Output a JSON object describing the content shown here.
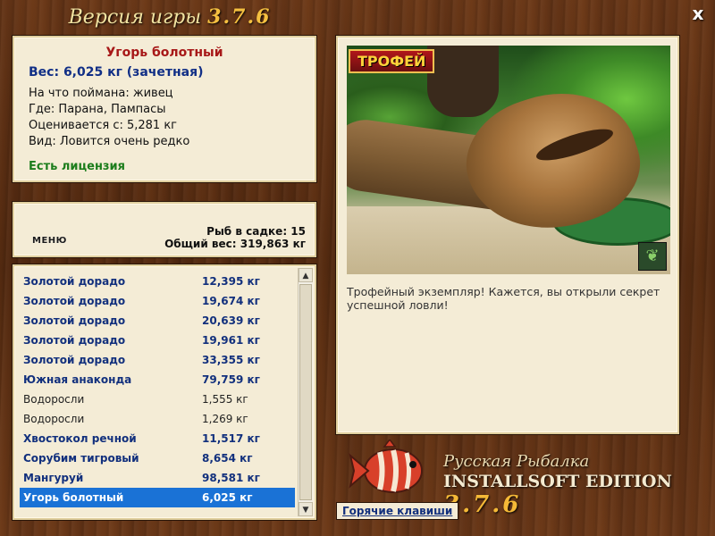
{
  "window": {
    "title_prefix": "Версия игры",
    "title_version": "3.7.6",
    "close_label": "x"
  },
  "info": {
    "fish_name": "Угорь болотный",
    "weight": "Вес: 6,025 кг (зачетная)",
    "bait": "На что поймана: живец",
    "location": "Где: Парана, Пампасы",
    "rated_from": "Оценивается с: 5,281 кг",
    "rarity": "Вид: Ловится очень редко",
    "license": "Есть лицензия"
  },
  "status": {
    "menu_label": "МЕНЮ",
    "fish_in_cage": "Рыб в садке: 15",
    "total_weight": "Общий вес: 319,863 кг"
  },
  "catch_list": [
    {
      "name": "Золотой дорадо",
      "weight": "12,395 кг",
      "style": "b"
    },
    {
      "name": "Золотой дорадо",
      "weight": "19,674 кг",
      "style": "b"
    },
    {
      "name": "Золотой дорадо",
      "weight": "20,639 кг",
      "style": "b"
    },
    {
      "name": "Золотой дорадо",
      "weight": "19,961 кг",
      "style": "b"
    },
    {
      "name": "Золотой дорадо",
      "weight": "33,355 кг",
      "style": "b"
    },
    {
      "name": "Южная анаконда",
      "weight": "79,759 кг",
      "style": "b"
    },
    {
      "name": "Водоросли",
      "weight": "1,555 кг",
      "style": "p"
    },
    {
      "name": "Водоросли",
      "weight": "1,269 кг",
      "style": "p"
    },
    {
      "name": "Хвостокол речной",
      "weight": "11,517 кг",
      "style": "b"
    },
    {
      "name": "Сорубим тигровый",
      "weight": "8,654 кг",
      "style": "b"
    },
    {
      "name": "Мангуруй",
      "weight": "98,581 кг",
      "style": "b"
    },
    {
      "name": "Угорь болотный",
      "weight": "6,025 кг",
      "style": "sel"
    }
  ],
  "photo": {
    "badge": "ТРОФЕЙ",
    "description": "Трофейный экземпляр! Кажется, вы открыли секрет успешной ловли!"
  },
  "logo": {
    "line1": "Русская Рыбалка",
    "line2": "INSTALLSOFT EDITION",
    "version": "3.7.6"
  },
  "hotkeys_label": "Горячие клавиши"
}
